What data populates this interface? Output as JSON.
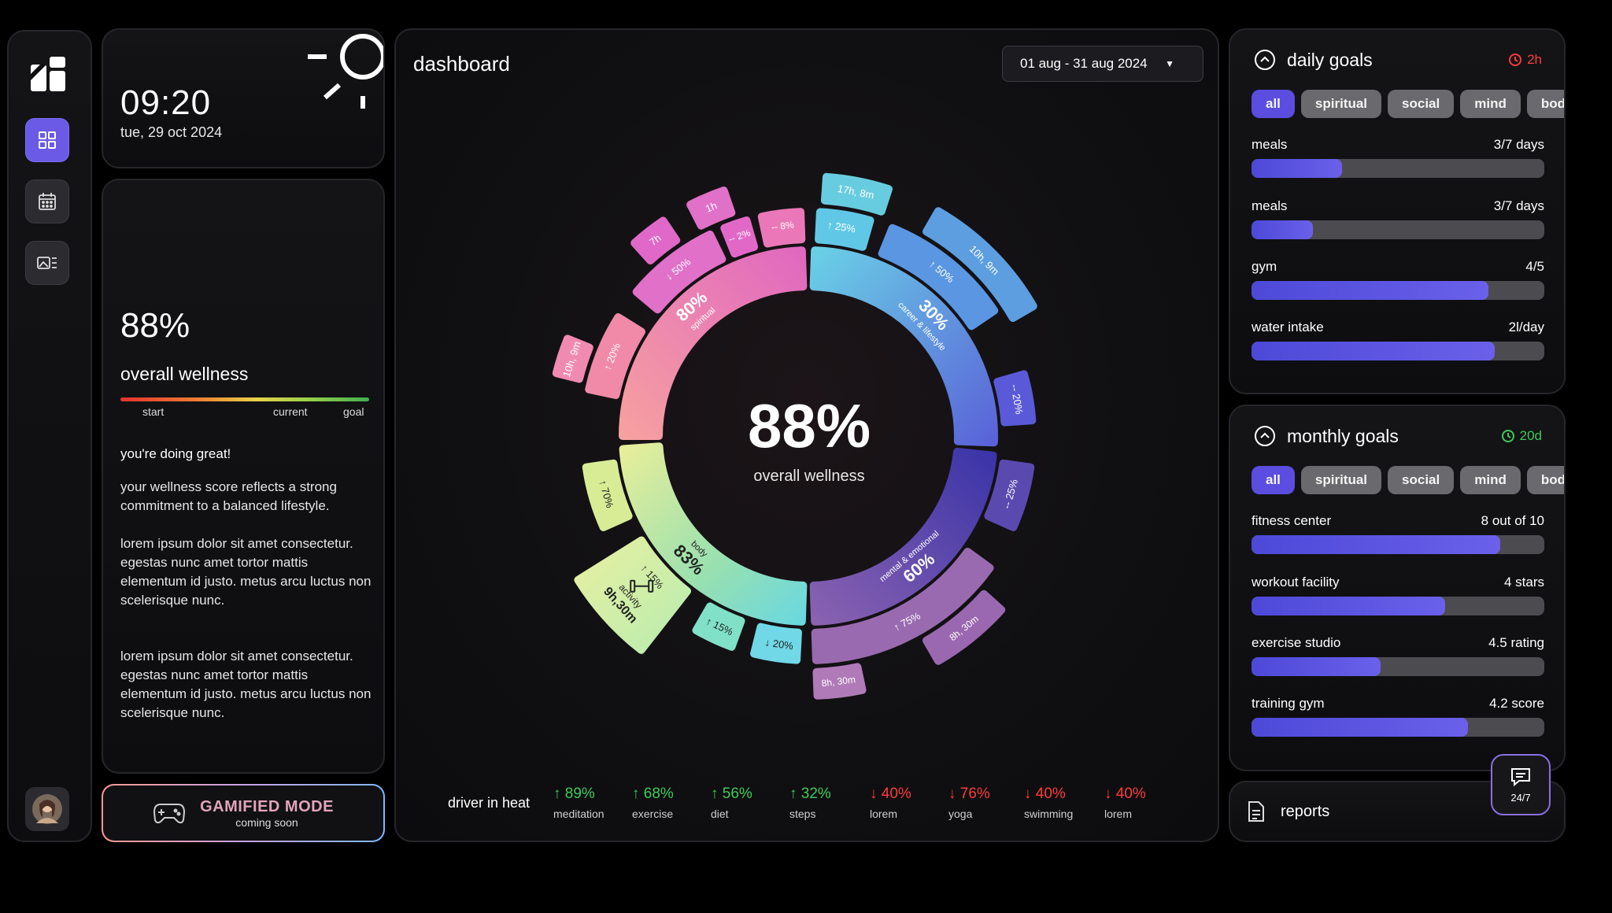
{
  "sidebar": {
    "items": [
      {
        "name": "dashboard",
        "icon": "grid-icon",
        "active": true
      },
      {
        "name": "calendar",
        "icon": "calendar-icon",
        "active": false
      },
      {
        "name": "gallery",
        "icon": "media-icon",
        "active": false
      }
    ]
  },
  "clock": {
    "time": "09:20",
    "date": "tue, 29 oct 2024"
  },
  "wellness": {
    "percent": "88%",
    "label": "overall wellness",
    "bar_labels": {
      "start": "start",
      "current": "current",
      "goal": "goal"
    },
    "message_title": "you're doing great!",
    "paragraphs": [
      "your wellness score reflects a strong commitment to a balanced lifestyle.",
      "lorem ipsum dolor sit amet consectetur. egestas nunc amet tortor mattis elementum id justo. metus arcu luctus non scelerisque nunc.",
      "lorem ipsum dolor sit amet consectetur. egestas nunc amet tortor mattis elementum id justo. metus arcu luctus non scelerisque nunc."
    ]
  },
  "gamified": {
    "title": "GAMIFIED MODE",
    "subtitle": "coming soon"
  },
  "dashboard": {
    "title": "dashboard",
    "date_range": "01 aug - 31 aug 2024",
    "center_percent": "88%",
    "center_label": "overall wellness",
    "segments": {
      "spiritual": {
        "pct": "80%",
        "name": "spiritual"
      },
      "career": {
        "pct": "30%",
        "name": "career & lifestyle"
      },
      "mental": {
        "pct": "60%",
        "name": "mental & emotional"
      },
      "body": {
        "pct": "83%",
        "name": "body"
      },
      "activity": {
        "name": "activity",
        "value": "9h,30m"
      },
      "outer": {
        "s1": "↓ 50%",
        "s2": "↑ 20%",
        "s3": "-- 2%",
        "s4": "-- 8%",
        "s5": "7h",
        "s6": "1h",
        "s7": "10h, 9m",
        "c1": "↑ 25%",
        "c2": "↑ 50%",
        "c3": "-- 20%",
        "c4": "17h, 8m",
        "c5": "10h, 9m",
        "m1": "↑ 75%",
        "m2": "-- 25%",
        "m3": "8h, 30m",
        "m4": "8h, 30m",
        "b1": "↑ 70%",
        "b2": "↑ 15%",
        "b3": "↑ 15%",
        "b4": "↓ 20%"
      }
    },
    "drivers_title": "driver in heat",
    "drivers": [
      {
        "value": "↑ 89%",
        "label": "meditation",
        "dir": "up"
      },
      {
        "value": "↑ 68%",
        "label": "exercise",
        "dir": "up"
      },
      {
        "value": "↑ 56%",
        "label": "diet",
        "dir": "up"
      },
      {
        "value": "↑ 32%",
        "label": "steps",
        "dir": "up"
      },
      {
        "value": "↓ 40%",
        "label": "lorem",
        "dir": "down"
      },
      {
        "value": "↓ 76%",
        "label": "yoga",
        "dir": "down"
      },
      {
        "value": "↓ 40%",
        "label": "swimming",
        "dir": "down"
      },
      {
        "value": "↓ 40%",
        "label": "lorem",
        "dir": "down"
      }
    ]
  },
  "daily_goals": {
    "title": "daily goals",
    "timer": "2h",
    "timer_color": "#ff3b3b",
    "chips": [
      "all",
      "spiritual",
      "social",
      "mind",
      "bod"
    ],
    "items": [
      {
        "name": "meals",
        "amount": "3/7 days",
        "progress": 0.31
      },
      {
        "name": "meals",
        "amount": "3/7 days",
        "progress": 0.21
      },
      {
        "name": "gym",
        "amount": "4/5",
        "progress": 0.81
      },
      {
        "name": "water intake",
        "amount": "2l/day",
        "progress": 0.83
      }
    ]
  },
  "monthly_goals": {
    "title": "monthly goals",
    "timer": "20d",
    "timer_color": "#3ecb5a",
    "chips": [
      "all",
      "spiritual",
      "social",
      "mind",
      "bod"
    ],
    "items": [
      {
        "name": "fitness center",
        "amount": "8 out of 10",
        "progress": 0.85
      },
      {
        "name": "workout facility",
        "amount": "4 stars",
        "progress": 0.66
      },
      {
        "name": "exercise studio",
        "amount": "4.5 rating",
        "progress": 0.44
      },
      {
        "name": "training gym",
        "amount": "4.2 score",
        "progress": 0.74
      }
    ]
  },
  "reports": {
    "label": "reports"
  },
  "chat": {
    "label": "24/7"
  },
  "colors": {
    "accent": "#6a5ae6",
    "up": "#3ecb5a",
    "down": "#ff3b3b"
  }
}
